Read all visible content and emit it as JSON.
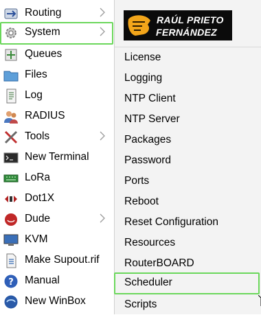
{
  "left_menu": {
    "items": [
      {
        "label": "Routing",
        "icon": "routing-icon",
        "has_submenu": true
      },
      {
        "label": "System",
        "icon": "gear-icon",
        "has_submenu": true,
        "selected": true
      },
      {
        "label": "Queues",
        "icon": "queues-icon",
        "has_submenu": false
      },
      {
        "label": "Files",
        "icon": "folder-icon",
        "has_submenu": false
      },
      {
        "label": "Log",
        "icon": "log-icon",
        "has_submenu": false
      },
      {
        "label": "RADIUS",
        "icon": "users-icon",
        "has_submenu": false
      },
      {
        "label": "Tools",
        "icon": "tools-icon",
        "has_submenu": true
      },
      {
        "label": "New Terminal",
        "icon": "terminal-icon",
        "has_submenu": false
      },
      {
        "label": "LoRa",
        "icon": "lora-icon",
        "has_submenu": false
      },
      {
        "label": "Dot1X",
        "icon": "dot1x-icon",
        "has_submenu": false
      },
      {
        "label": "Dude",
        "icon": "dude-icon",
        "has_submenu": true
      },
      {
        "label": "KVM",
        "icon": "monitor-icon",
        "has_submenu": false
      },
      {
        "label": "Make Supout.rif",
        "icon": "document-icon",
        "has_submenu": false
      },
      {
        "label": "Manual",
        "icon": "help-icon",
        "has_submenu": false
      },
      {
        "label": "New WinBox",
        "icon": "winbox-icon",
        "has_submenu": false
      }
    ]
  },
  "logo": {
    "line1": "RAÚL PRIETO",
    "line2": "FERNÁNDEZ"
  },
  "submenu": {
    "items": [
      {
        "label": "License"
      },
      {
        "label": "Logging"
      },
      {
        "label": "NTP Client"
      },
      {
        "label": "NTP Server"
      },
      {
        "label": "Packages"
      },
      {
        "label": "Password"
      },
      {
        "label": "Ports"
      },
      {
        "label": "Reboot"
      },
      {
        "label": "Reset Configuration"
      },
      {
        "label": "Resources"
      },
      {
        "label": "RouterBOARD"
      },
      {
        "label": "Scheduler",
        "selected": true
      },
      {
        "label": "Scripts"
      }
    ]
  },
  "colors": {
    "highlight": "#6ad75a",
    "submenu_bg": "#f3f3f3",
    "logo_bg": "#0b0b0b",
    "logo_accent": "#f2a51a"
  }
}
